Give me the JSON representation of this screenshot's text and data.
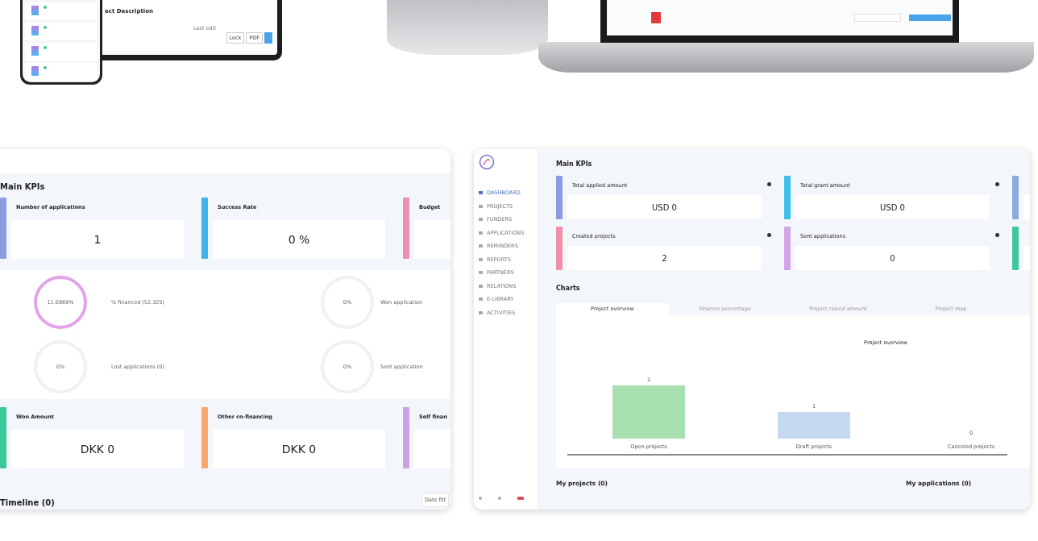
{
  "tablet": {
    "section_title": "ect Description",
    "column": "Last edit",
    "buttons": [
      "Lock",
      "PDF"
    ]
  },
  "phone": {
    "rows": [
      {
        "color": "#3cc98a"
      },
      {
        "color": "#3cc98a"
      },
      {
        "color": "#3cc98a"
      },
      {
        "color": "#3cc98a"
      }
    ]
  },
  "left_window": {
    "title": "Main KPIs",
    "kpis": [
      {
        "label": "Number of applications",
        "value": "1",
        "color": "#8e9be0"
      },
      {
        "label": "Success Rate",
        "value": "0 %",
        "color": "#3fb3ea"
      },
      {
        "label": "Budget",
        "color": "#f08fb0"
      }
    ],
    "donuts": [
      {
        "ring_text": "11.0869%",
        "label": "% financed (52.325)",
        "color": "#e3a3ea"
      },
      {
        "ring_text": "0%",
        "label": "Won application",
        "color": "#f0f0f5"
      },
      {
        "ring_text": "0%",
        "label": "Lost applications (0)",
        "color": "#f0f0f5"
      },
      {
        "ring_text": "0%",
        "label": "Sent application",
        "color": "#f0f0f5"
      }
    ],
    "kpis_2": [
      {
        "label": "Won Amount",
        "value": "DKK 0",
        "color": "#3cc99a"
      },
      {
        "label": "Other co-financing",
        "value": "DKK 0",
        "color": "#f9a86a"
      },
      {
        "label": "Self finan",
        "color": "#c9a2e6"
      }
    ],
    "timeline": "Timeline (0)",
    "filter_button": "Date filt"
  },
  "right_window": {
    "sidebar": [
      {
        "label": "DASHBOARD",
        "selected": true
      },
      {
        "label": "PROJECTS",
        "selected": false
      },
      {
        "label": "FUNDERS",
        "selected": false
      },
      {
        "label": "APPLICATIONS",
        "selected": false
      },
      {
        "label": "REMINDERS",
        "selected": false
      },
      {
        "label": "REPORTS",
        "selected": false
      },
      {
        "label": "PARTNERS",
        "selected": false
      },
      {
        "label": "RELATIONS",
        "selected": false
      },
      {
        "label": "E-LIBRARY",
        "selected": false
      },
      {
        "label": "ACTIVITIES",
        "selected": false
      }
    ],
    "title": "Main KPIs",
    "kpis": [
      {
        "label": "Total applied amount",
        "value": "USD 0",
        "color": "#8e9be0"
      },
      {
        "label": "Total grant amount",
        "value": "USD 0",
        "color": "#3fc0ea"
      },
      {
        "color": "#8ea8e0"
      },
      {
        "label": "Created projects",
        "value": "2",
        "color": "#f08fa8"
      },
      {
        "label": "Sent applications",
        "value": "0",
        "color": "#d2a6e6"
      },
      {
        "color": "#3cc99a"
      }
    ],
    "charts_title": "Charts",
    "chart_tabs": [
      {
        "label": "Project overview",
        "selected": true
      },
      {
        "label": "Finance percentage",
        "selected": false
      },
      {
        "label": "Project raised amount",
        "selected": false
      },
      {
        "label": "Project map",
        "selected": false
      }
    ],
    "chart_data": {
      "type": "bar",
      "title": "Project overview",
      "categories": [
        "Open projects",
        "Draft projects",
        "Canceled projects"
      ],
      "series": [
        {
          "color": "#a8dfb0",
          "values": [
            2,
            null,
            null
          ]
        },
        {
          "color": "#c4d8f2",
          "values": [
            null,
            1,
            null
          ]
        },
        {
          "color": "#e8e8ee",
          "values": [
            null,
            null,
            0
          ]
        }
      ],
      "data_labels": true
    },
    "my_projects": "My projects (0)",
    "my_applications": "My applications (0)"
  }
}
